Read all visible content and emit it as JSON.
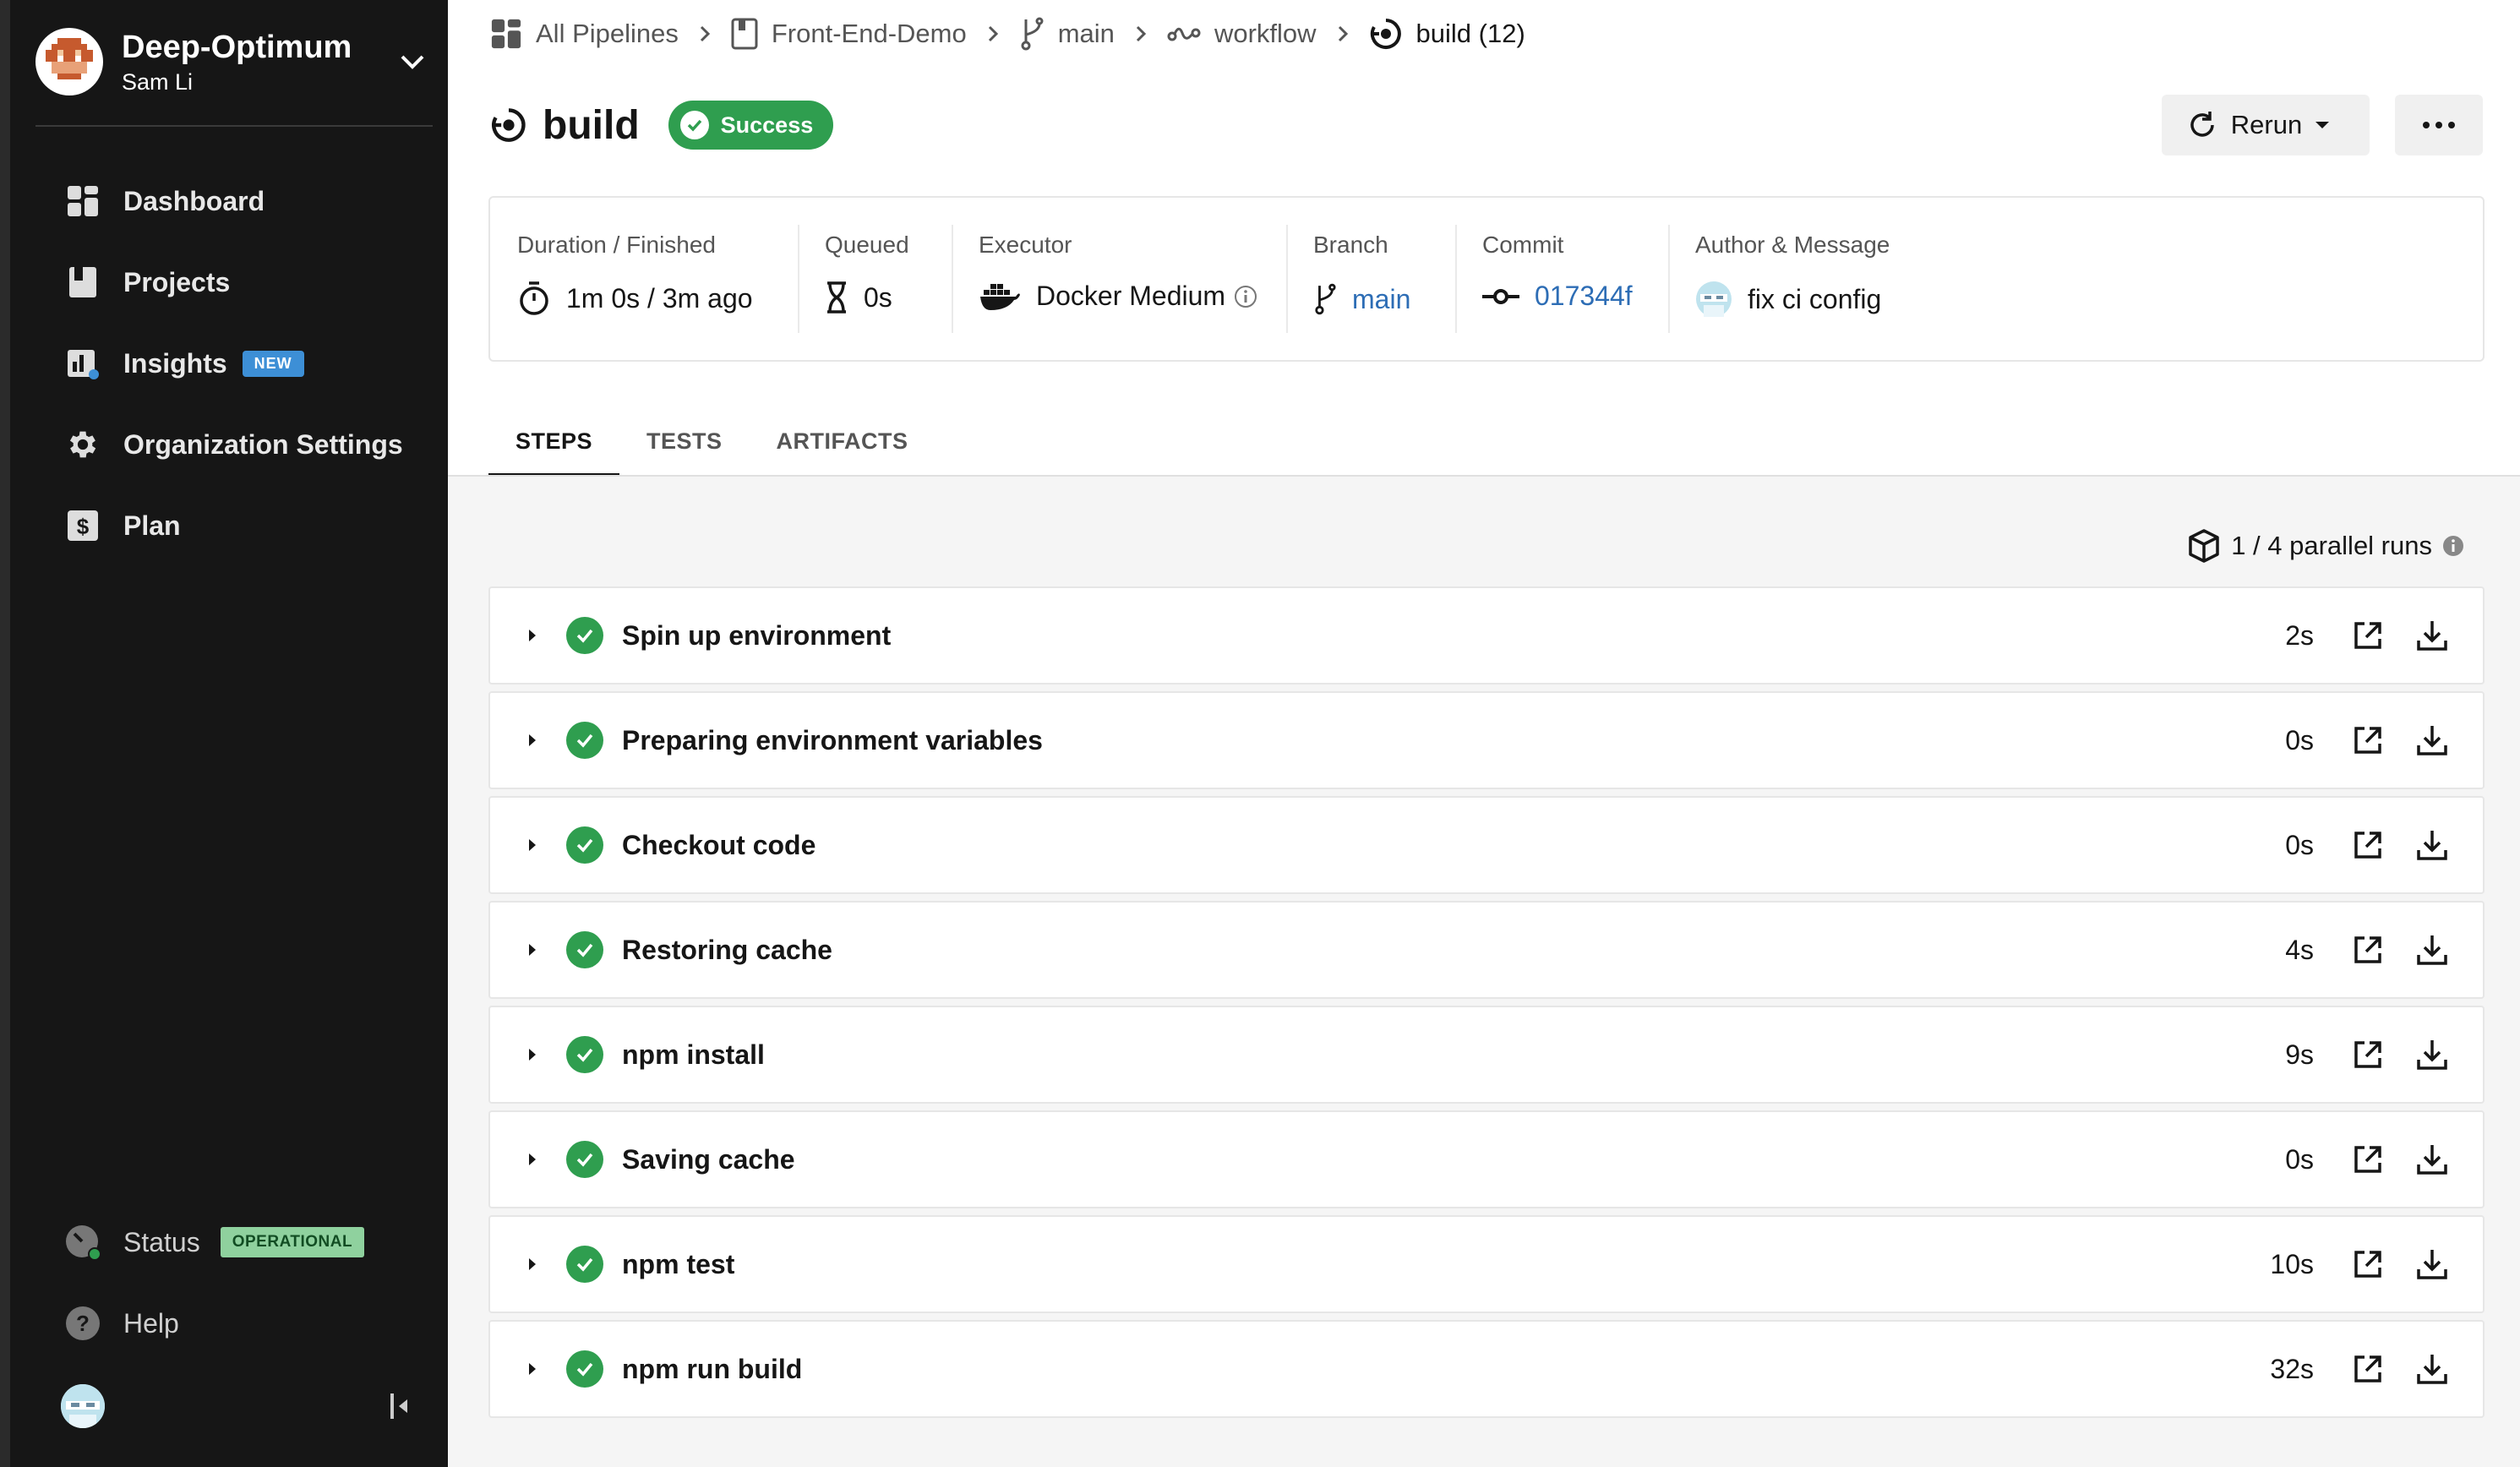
{
  "org": {
    "name": "Deep-Optimum",
    "user": "Sam Li"
  },
  "sidebar": {
    "items": [
      {
        "label": "Dashboard",
        "icon": "dashboard-icon"
      },
      {
        "label": "Projects",
        "icon": "projects-icon"
      },
      {
        "label": "Insights",
        "icon": "insights-icon",
        "badge": "NEW"
      },
      {
        "label": "Organization Settings",
        "icon": "gear-icon"
      },
      {
        "label": "Plan",
        "icon": "dollar-icon"
      }
    ],
    "status_label": "Status",
    "status_badge": "OPERATIONAL",
    "help_label": "Help"
  },
  "breadcrumb": [
    {
      "label": "All Pipelines",
      "icon": "pipelines-icon"
    },
    {
      "label": "Front-End-Demo",
      "icon": "project-icon"
    },
    {
      "label": "main",
      "icon": "branch-icon"
    },
    {
      "label": "workflow",
      "icon": "workflow-icon"
    },
    {
      "label": "build (12)",
      "icon": "job-icon"
    }
  ],
  "job": {
    "title": "build",
    "status": "Success"
  },
  "actions": {
    "rerun_label": "Rerun"
  },
  "meta": {
    "duration_label": "Duration / Finished",
    "duration_value": "1m 0s / 3m ago",
    "queued_label": "Queued",
    "queued_value": "0s",
    "executor_label": "Executor",
    "executor_value": "Docker Medium",
    "branch_label": "Branch",
    "branch_value": "main",
    "commit_label": "Commit",
    "commit_value": "017344f",
    "author_label": "Author & Message",
    "author_message": "fix ci config"
  },
  "tabs": [
    "STEPS",
    "TESTS",
    "ARTIFACTS"
  ],
  "parallel_runs": "1 / 4 parallel runs",
  "steps": [
    {
      "name": "Spin up environment",
      "duration": "2s"
    },
    {
      "name": "Preparing environment variables",
      "duration": "0s"
    },
    {
      "name": "Checkout code",
      "duration": "0s"
    },
    {
      "name": "Restoring cache",
      "duration": "4s"
    },
    {
      "name": "npm install",
      "duration": "9s"
    },
    {
      "name": "Saving cache",
      "duration": "0s"
    },
    {
      "name": "npm test",
      "duration": "10s"
    },
    {
      "name": "npm run build",
      "duration": "32s"
    }
  ],
  "colors": {
    "success": "#2f9e4f",
    "link": "#2d6db5",
    "sidebar": "#161616",
    "new_badge": "#3d8fd6",
    "operational_badge": "#8fd19e"
  }
}
